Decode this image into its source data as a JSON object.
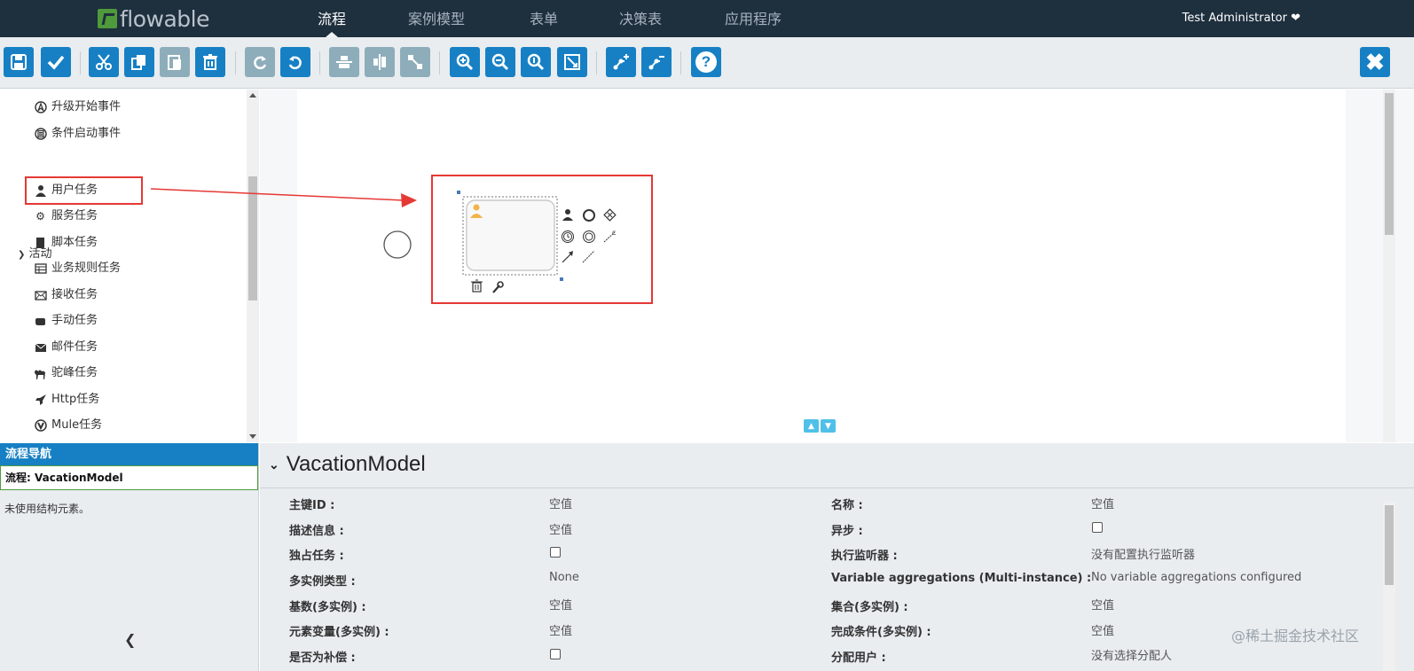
{
  "app": {
    "logo_text": "flowable",
    "user": "Test Administrator ❤"
  },
  "nav": {
    "tabs": [
      {
        "label": "流程",
        "active": true
      },
      {
        "label": "案例模型"
      },
      {
        "label": "表单"
      },
      {
        "label": "决策表"
      },
      {
        "label": "应用程序"
      }
    ]
  },
  "toolbar": {
    "buttons": [
      {
        "name": "save",
        "icon": "save-icon"
      },
      {
        "name": "validate",
        "icon": "check-icon"
      },
      {
        "name": "cut",
        "icon": "scissors-icon"
      },
      {
        "name": "copy",
        "icon": "copy-icon"
      },
      {
        "name": "paste",
        "icon": "paste-icon",
        "disabled": true
      },
      {
        "name": "delete",
        "icon": "trash-icon"
      },
      {
        "name": "redo",
        "icon": "redo-icon",
        "disabled": true
      },
      {
        "name": "undo",
        "icon": "undo-icon"
      },
      {
        "name": "align-vertical",
        "icon": "align-vertical-icon",
        "disabled": true
      },
      {
        "name": "align-horizontal",
        "icon": "align-horizontal-icon",
        "disabled": true
      },
      {
        "name": "same-size",
        "icon": "same-size-icon",
        "disabled": true
      },
      {
        "name": "zoom-in",
        "icon": "zoom-in-icon"
      },
      {
        "name": "zoom-out",
        "icon": "zoom-out-icon"
      },
      {
        "name": "zoom-actual",
        "icon": "zoom-actual-icon"
      },
      {
        "name": "zoom-fit",
        "icon": "zoom-fit-icon"
      },
      {
        "name": "add-bendpoint",
        "icon": "add-bendpoint-icon"
      },
      {
        "name": "remove-bendpoint",
        "icon": "remove-bendpoint-icon"
      }
    ],
    "help_label": "?",
    "close_label": "✖"
  },
  "palette": {
    "items_before": [
      {
        "label": "升级开始事件",
        "icon": "escalation-icon"
      },
      {
        "label": "条件启动事件",
        "icon": "conditional-icon"
      }
    ],
    "group_label": "活动",
    "activities": [
      {
        "label": "用户任务",
        "icon": "user-icon"
      },
      {
        "label": "服务任务",
        "icon": "gear-icon"
      },
      {
        "label": "脚本任务",
        "icon": "script-icon"
      },
      {
        "label": "业务规则任务",
        "icon": "table-icon"
      },
      {
        "label": "接收任务",
        "icon": "envelope-icon"
      },
      {
        "label": "手动任务",
        "icon": "hand-icon"
      },
      {
        "label": "邮件任务",
        "icon": "mail-icon"
      },
      {
        "label": "驼峰任务",
        "icon": "camel-icon"
      },
      {
        "label": "Http任务",
        "icon": "rocket-icon"
      },
      {
        "label": "Mule任务",
        "icon": "mule-icon"
      }
    ]
  },
  "navigator": {
    "title": "流程导航",
    "process_label": "流程: VacationModel",
    "note": "未使用结构元素。"
  },
  "properties": {
    "title": "VacationModel",
    "left": [
      {
        "label": "主键ID :",
        "value": "空值"
      },
      {
        "label": "描述信息 :",
        "value": "空值"
      },
      {
        "label": "独占任务 :",
        "checkbox": true
      },
      {
        "label": "多实例类型 :",
        "value": "None"
      },
      {
        "label": "基数(多实例) :",
        "value": "空值"
      },
      {
        "label": "元素变量(多实例) :",
        "value": "空值"
      },
      {
        "label": "是否为补偿 :",
        "checkbox": true
      }
    ],
    "right": [
      {
        "label": "名称 :",
        "value": "空值"
      },
      {
        "label": "异步 :",
        "checkbox": true
      },
      {
        "label": "执行监听器 :",
        "value": "没有配置执行监听器"
      },
      {
        "label": "Variable aggregations (Multi-instance) :",
        "value": "No variable aggregations configured"
      },
      {
        "label": "集合(多实例) :",
        "value": "空值"
      },
      {
        "label": "完成条件(多实例) :",
        "value": "空值"
      },
      {
        "label": "分配用户 :",
        "value": "没有选择分配人"
      }
    ]
  },
  "watermark": "@稀土掘金技术社区",
  "colors": {
    "navbar": "#1e2f3e",
    "accent": "#1780c4",
    "highlight": "#e53935"
  }
}
